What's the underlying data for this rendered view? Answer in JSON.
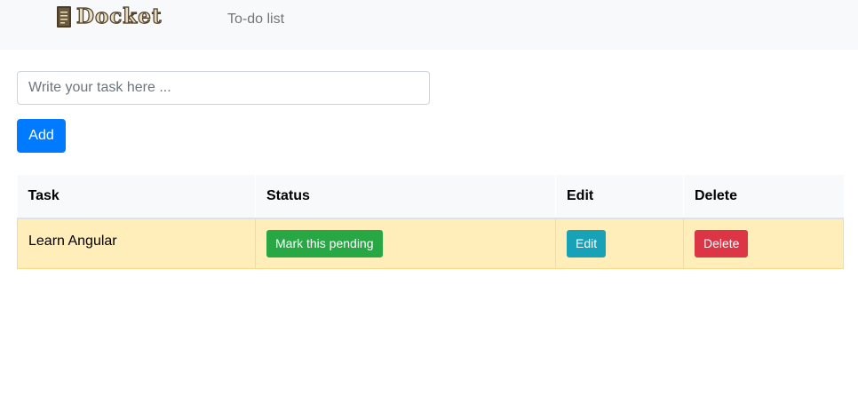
{
  "navbar": {
    "brand": {
      "name": "Docket",
      "icon": "notebook-icon"
    },
    "link": "To-do list"
  },
  "form": {
    "placeholder": "Write your task here ...",
    "value": "",
    "add_label": "Add"
  },
  "table": {
    "headers": [
      "Task",
      "Status",
      "Edit",
      "Delete"
    ],
    "rows": [
      {
        "task": "Learn Angular",
        "status_label": "Mark this pending",
        "edit_label": "Edit",
        "delete_label": "Delete"
      }
    ]
  },
  "colors": {
    "primary": "#007bff",
    "success": "#28a745",
    "info": "#17a2b8",
    "danger": "#dc3545",
    "row_highlight": "#ffeeba",
    "navbar_bg": "#f8f9fa"
  }
}
